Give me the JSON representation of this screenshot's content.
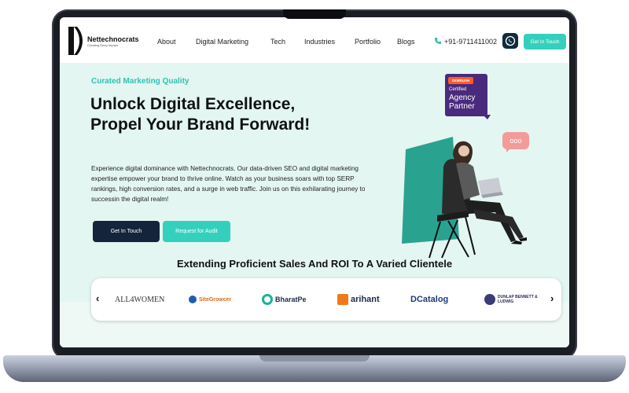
{
  "brand": {
    "name": "Nettechnocrats",
    "tagline": "Creating Deep Impact"
  },
  "nav": {
    "links": [
      "About",
      "Digital Marketing",
      "Tech",
      "Industries",
      "Portfolio",
      "Blogs"
    ],
    "phone": "+91-9711411002",
    "cta_label": "Get In Touch"
  },
  "hero": {
    "eyebrow": "Curated Marketing Quality",
    "headline": "Unlock Digital Excellence, Propel Your Brand Forward!",
    "body": "Experience digital dominance with Nettechnocrats. Our data-driven SEO and digital marketing expertise empower your brand to thrive online. Watch as your business soars with top SERP rankings, high conversion rates, and a surge in web traffic. Join us on this exhilarating journey to successin the digital realm!",
    "primary_button": "Get In Touch",
    "secondary_button": "Request for Audit"
  },
  "badge": {
    "logo_text": "SEMRUSH",
    "line1": "Certified",
    "line2": "Agency",
    "line3": "Partner"
  },
  "chat_bubble": "ooo",
  "clients": {
    "title": "Extending Proficient Sales And ROI To A Varied Clientele",
    "prev_arrow": "‹",
    "next_arrow": "›",
    "logos": [
      "ALL4WOMEN",
      "SiteGrowcer",
      "BharatPe",
      "arihant",
      "DCatalog",
      "DUNLAP BENNETT & LUDWIG"
    ]
  },
  "colors": {
    "teal": "#35d0bd",
    "navy": "#14243a",
    "hero_bg": "#e3f6f2",
    "badge_purple": "#4a2a7c",
    "chat_pink": "#f19b9b"
  }
}
